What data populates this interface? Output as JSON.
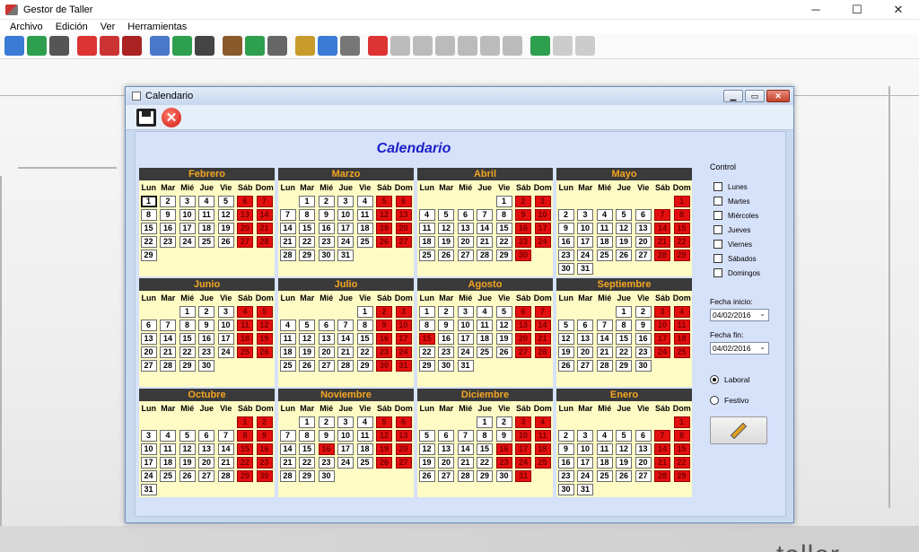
{
  "app": {
    "title": "Gestor de Taller"
  },
  "window_controls": {
    "minimize": "─",
    "maximize": "☐",
    "close": "✕"
  },
  "menu": [
    "Archivo",
    "Edición",
    "Ver",
    "Herramientas"
  ],
  "toolbar_icons": [
    "users-icon",
    "clients-icon",
    "group-icon",
    "car-red-icon",
    "car-add-icon",
    "car-search-icon",
    "document-icon",
    "document-add-icon",
    "binoculars-icon",
    "tools-icon",
    "tool-search-icon",
    "tool-binoculars-icon",
    "calendar-icon",
    "chart-icon",
    "database-icon",
    "car-export-icon",
    "save-disabled-icon",
    "add-disabled-icon",
    "remove-disabled-icon",
    "refresh-disabled-icon",
    "stop-disabled-icon",
    "cancel-disabled-icon",
    "car-check-icon",
    "back-disabled-icon",
    "forward-disabled-icon"
  ],
  "dialog": {
    "title": "Calendario",
    "heading": "Calendario",
    "weekdays": [
      "Lun",
      "Mar",
      "Mié",
      "Jue",
      "Vie",
      "Sáb",
      "Dom"
    ],
    "months": [
      {
        "name": "Febrero",
        "start": 0,
        "days": 29
      },
      {
        "name": "Marzo",
        "start": 1,
        "days": 31
      },
      {
        "name": "Abril",
        "start": 4,
        "days": 30
      },
      {
        "name": "Mayo",
        "start": 6,
        "days": 31
      },
      {
        "name": "Junio",
        "start": 2,
        "days": 30
      },
      {
        "name": "Julio",
        "start": 4,
        "days": 31
      },
      {
        "name": "Agosto",
        "start": 0,
        "days": 31
      },
      {
        "name": "Septiembre",
        "start": 3,
        "days": 30
      },
      {
        "name": "Octubre",
        "start": 5,
        "days": 31
      },
      {
        "name": "Noviembre",
        "start": 1,
        "days": 30
      },
      {
        "name": "Diciembre",
        "start": 3,
        "days": 31
      },
      {
        "name": "Enero",
        "start": 6,
        "days": 31
      }
    ],
    "extra_holidays": [
      {
        "month": "Agosto",
        "day": 15
      },
      {
        "month": "Noviembre",
        "day": 16
      },
      {
        "month": "Diciembre",
        "day": 16
      },
      {
        "month": "Diciembre",
        "day": 23
      }
    ],
    "highlighted_day": {
      "month": "Febrero",
      "day": 1
    },
    "control_label": "Control",
    "checkboxes": [
      "Lunes",
      "Martes",
      "Miércoles",
      "Jueves",
      "Viernes",
      "Sábados",
      "Domingos"
    ],
    "fecha_inicio_label": "Fecha inicio:",
    "fecha_inicio": "04/02/2016",
    "fecha_fin_label": "Fecha fin:",
    "fecha_fin": "04/02/2016",
    "radios": [
      {
        "label": "Laboral",
        "checked": true
      },
      {
        "label": "Festivo",
        "checked": false
      }
    ]
  },
  "background": {
    "brand": "taller"
  },
  "colors": {
    "weekend": "#e30f0f",
    "month_header": "#3a3a3a",
    "month_title": "#f5a623",
    "heading": "#1a20c8"
  }
}
